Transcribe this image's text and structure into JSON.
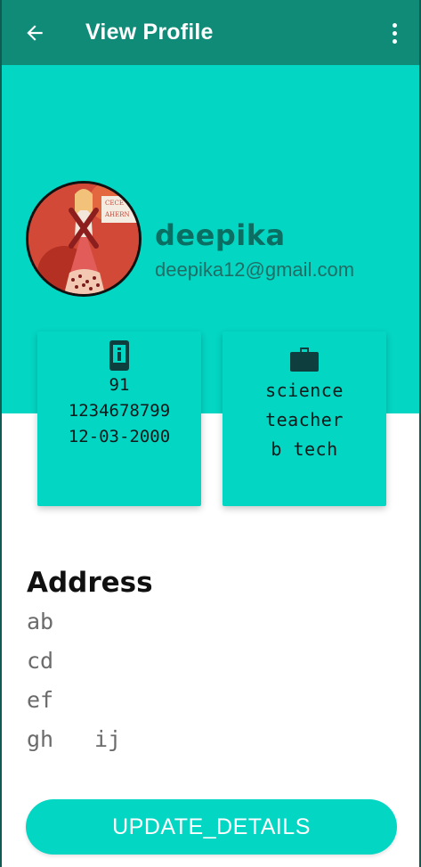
{
  "appbar": {
    "title": "View Profile",
    "back_icon": "arrow-left-icon",
    "menu_icon": "more-vert-icon"
  },
  "profile": {
    "name": "deepika",
    "email": "deepika12@gmail.com",
    "avatar_lettering": [
      "CECE",
      "AHERN"
    ]
  },
  "contact_card": {
    "icon": "phone-icon",
    "country_code": "91",
    "phone": "1234678799",
    "dob": "12-03-2000"
  },
  "work_card": {
    "icon": "briefcase-icon",
    "subject": "science",
    "role": "teacher",
    "qualification": "b tech"
  },
  "address": {
    "title": "Address",
    "line1": "ab",
    "line2": "cd",
    "line3": "ef",
    "line4": "gh",
    "line4b": "ij"
  },
  "actions": {
    "update_label": "UPDATE_DETAILS"
  },
  "colors": {
    "appbar": "#0f8b78",
    "accent": "#04d6c4",
    "name": "#0a6e62"
  }
}
